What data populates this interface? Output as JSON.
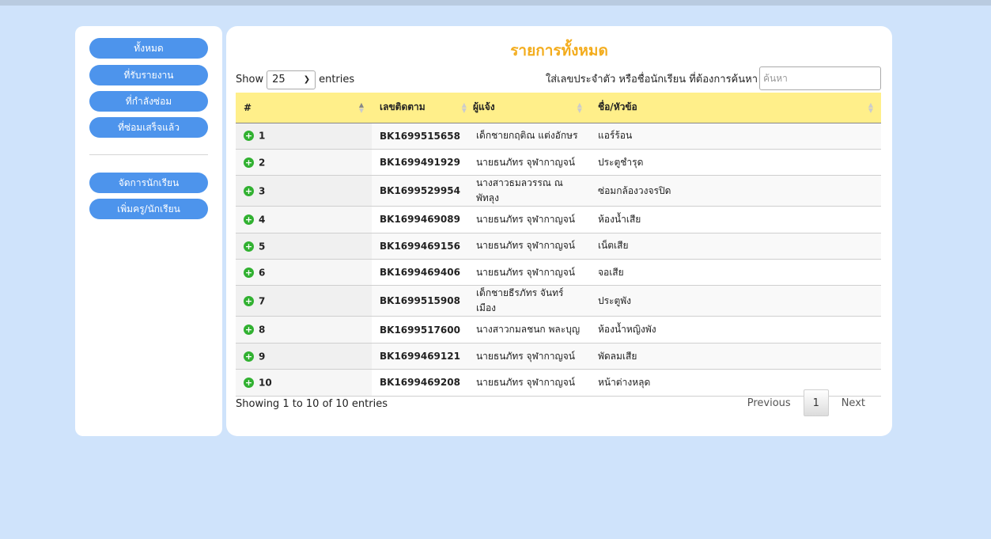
{
  "sidebar": {
    "items": [
      {
        "label": "ทั้งหมด"
      },
      {
        "label": "ที่รับรายงาน"
      },
      {
        "label": "ที่กำลังซ่อม"
      },
      {
        "label": "ที่ซ่อมเสร็จแล้ว"
      },
      {
        "label": "จัดการนักเรียน"
      },
      {
        "label": "เพิ่มครู/นักเรียน"
      }
    ]
  },
  "main": {
    "title": "รายการทั้งหมด",
    "show_label": "Show",
    "entries_label": "entries",
    "page_length": "25",
    "search_label": "ใส่เลขประจำตัว หรือชื่อนักเรียน ที่ต้องการค้นหา",
    "search_placeholder": "ค้นหา",
    "columns": [
      "#",
      "เลขติดตาม",
      "ผู้แจ้ง",
      "ชื่อ/หัวข้อ"
    ],
    "rows": [
      {
        "num": "1",
        "tracking": "BK1699515658",
        "reporter": "เด็กชายกฤติณ แต่งอักษร",
        "subject": "แอร์ร้อน"
      },
      {
        "num": "2",
        "tracking": "BK1699491929",
        "reporter": "นายธนภัทร จุฬากาญจน์",
        "subject": "ประตูชำรุด"
      },
      {
        "num": "3",
        "tracking": "BK1699529954",
        "reporter": "นางสาวธมลวรรณ ณ พัทลุง",
        "subject": "ซ่อมกล้องวงจรปิด"
      },
      {
        "num": "4",
        "tracking": "BK1699469089",
        "reporter": "นายธนภัทร จุฬากาญจน์",
        "subject": "ห้องน้ำเสีย"
      },
      {
        "num": "5",
        "tracking": "BK1699469156",
        "reporter": "นายธนภัทร จุฬากาญจน์",
        "subject": "เน็ตเสีย"
      },
      {
        "num": "6",
        "tracking": "BK1699469406",
        "reporter": "นายธนภัทร จุฬากาญจน์",
        "subject": "จอเสีย"
      },
      {
        "num": "7",
        "tracking": "BK1699515908",
        "reporter": "เด็กชายธีรภัทร จันทร์เมือง",
        "subject": "ประตูพัง"
      },
      {
        "num": "8",
        "tracking": "BK1699517600",
        "reporter": "นางสาวกมลชนก พละบุญ",
        "subject": "ห้องน้ำหญิงพัง"
      },
      {
        "num": "9",
        "tracking": "BK1699469121",
        "reporter": "นายธนภัทร จุฬากาญจน์",
        "subject": "พัดลมเสีย"
      },
      {
        "num": "10",
        "tracking": "BK1699469208",
        "reporter": "นายธนภัทร จุฬากาญจน์",
        "subject": "หน้าต่างหลุด"
      }
    ],
    "info": "Showing 1 to 10 of 10 entries",
    "pagination": {
      "previous": "Previous",
      "current": "1",
      "next": "Next"
    }
  },
  "colors": {
    "background": "#cfe3fb",
    "sidebar_button": "#4d94ec",
    "title": "#f3ac1c",
    "table_header": "#ffef8a",
    "expand_icon": "#31b131"
  },
  "icons": {
    "row_expand": "plus-circle-icon",
    "select_dropdown": "chevron-down-icon",
    "sort": "sort-arrows-icon"
  }
}
